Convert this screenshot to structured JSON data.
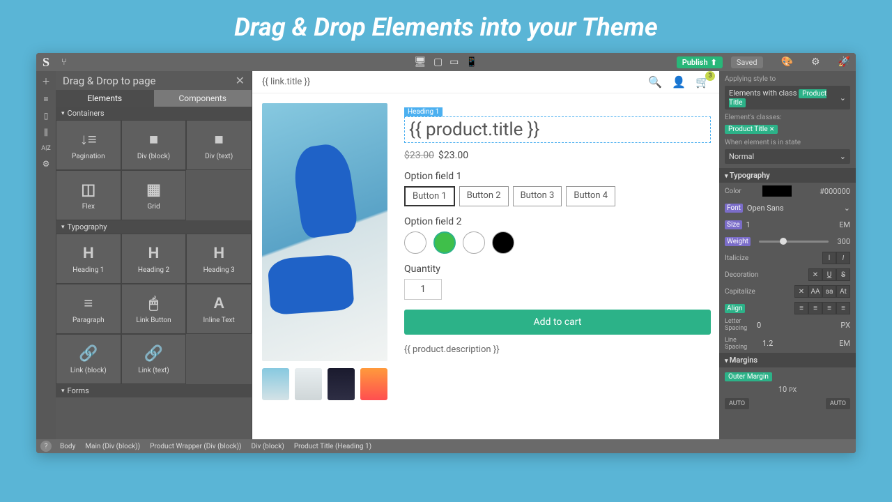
{
  "hero_title": "Drag & Drop Elements into your Theme",
  "topbar": {
    "publish": "Publish",
    "saved": "Saved"
  },
  "leftpanel": {
    "title": "Drag & Drop to page",
    "tabs": {
      "elements": "Elements",
      "components": "Components"
    },
    "sections": {
      "containers": "Containers",
      "typography": "Typography",
      "forms": "Forms"
    },
    "items": {
      "pagination": "Pagination",
      "div_block": "Div (block)",
      "div_text": "Div (text)",
      "flex": "Flex",
      "grid": "Grid",
      "heading1": "Heading 1",
      "heading2": "Heading 2",
      "heading3": "Heading 3",
      "paragraph": "Paragraph",
      "link_button": "Link Button",
      "inline_text": "Inline Text",
      "link_block": "Link (block)",
      "link_text": "Link (text)"
    }
  },
  "canvas": {
    "link_title": "{{ link.title }}",
    "cart_badge": "3",
    "heading_tag": "Heading 1",
    "product_title": "{{ product.title }}",
    "price_old": "$23.00",
    "price_new": "$23.00",
    "option1_label": "Option field 1",
    "option_buttons": [
      "Button 1",
      "Button 2",
      "Button 3",
      "Button 4"
    ],
    "option2_label": "Option field 2",
    "swatch_colors": [
      "#ffffff",
      "#3fbf4a",
      "#ffffff",
      "#000000"
    ],
    "quantity_label": "Quantity",
    "quantity_value": "1",
    "add_to_cart": "Add to cart",
    "description": "{{ product.description }}"
  },
  "inspector": {
    "applying_to": "Applying style to",
    "elements_with_class": "Elements with class",
    "class_tag": "Product Title",
    "element_classes_label": "Element's classes:",
    "state_label": "When element is in state",
    "state_value": "Normal",
    "typography_hdr": "Typography",
    "color_label": "Color",
    "color_value": "#000000",
    "font_label": "Font",
    "font_value": "Open Sans",
    "size_label": "Size",
    "size_value": "1",
    "size_unit": "EM",
    "weight_label": "Weight",
    "weight_value": "300",
    "italicize_label": "Italicize",
    "decoration_label": "Decoration",
    "capitalize_label": "Capitalize",
    "cap_opts": [
      "AA",
      "aa",
      "At"
    ],
    "align_label": "Align",
    "letter_spacing_label": "Letter Spacing",
    "letter_spacing_value": "0",
    "letter_spacing_unit": "PX",
    "line_spacing_label": "Line Spacing",
    "line_spacing_value": "1.2",
    "line_spacing_unit": "EM",
    "margins_hdr": "Margins",
    "outer_margin": "Outer Margin",
    "margin_value": "10",
    "margin_unit": "PX",
    "auto": "AUTO"
  },
  "breadcrumb": [
    "Body",
    "Main (Div (block))",
    "Product Wrapper (Div (block))",
    "Div (block)",
    "Product Title (Heading 1)"
  ]
}
